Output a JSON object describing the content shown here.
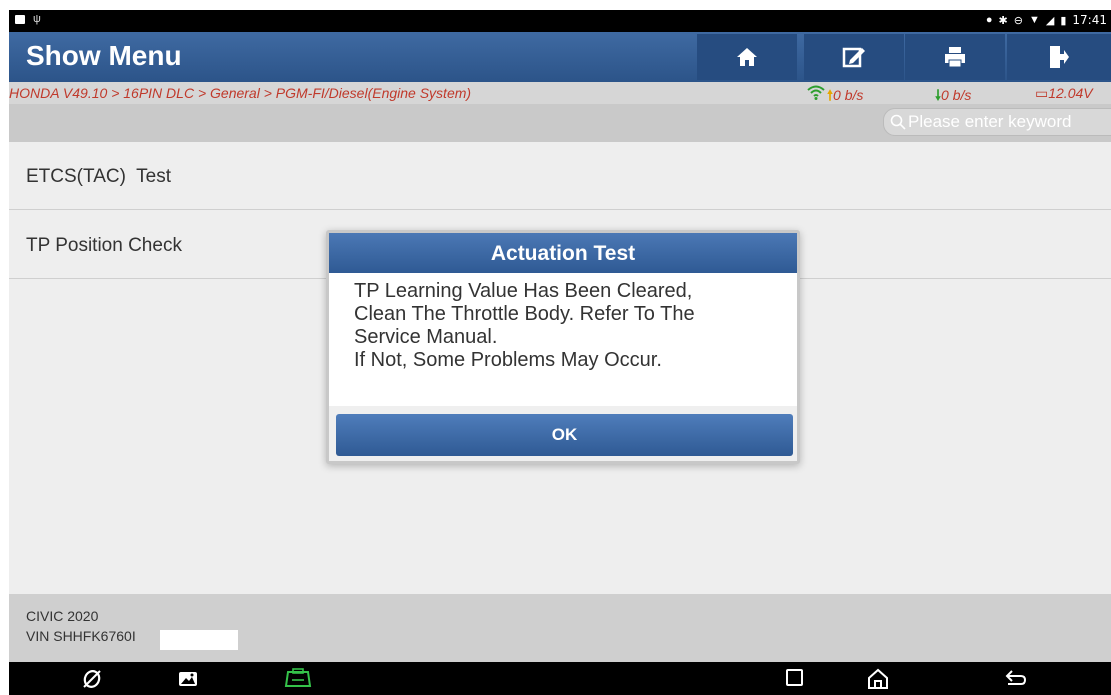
{
  "status_bar": {
    "time": "17:41",
    "icons": [
      "image-icon",
      "usb-icon",
      "location-icon",
      "bluetooth-icon",
      "dnd-icon",
      "wifi-icon",
      "signal-icon",
      "battery-icon"
    ]
  },
  "header": {
    "title": "Show Menu",
    "buttons": [
      "home-icon",
      "edit-report-icon",
      "print-icon",
      "exit-icon"
    ]
  },
  "breadcrumb": {
    "path": "HONDA V49.10 > 16PIN DLC > General > PGM-FI/Diesel(Engine System)",
    "upload_rate": "0 b/s",
    "download_rate": "0 b/s",
    "voltage": "12.04V"
  },
  "search": {
    "placeholder": "Please enter keyword"
  },
  "menu": {
    "items": [
      {
        "label": "ETCS(TAC)  Test"
      },
      {
        "label": "TP Position Check"
      }
    ]
  },
  "vehicle": {
    "model": "CIVIC 2020",
    "vin": "VIN SHHFK6760I"
  },
  "dialog": {
    "title": "Actuation Test",
    "message_lines": [
      "TP Learning Value Has Been Cleared,",
      "Clean The Throttle Body. Refer To The",
      "Service Manual.",
      "If Not, Some Problems May Occur."
    ],
    "ok_label": "OK"
  },
  "nav_bar": {
    "icons": [
      "browser-icon",
      "gallery-icon",
      "vci-icon",
      "recents-icon",
      "home-icon",
      "back-icon"
    ]
  },
  "colors": {
    "header_blue": "#2c5489",
    "breadcrumb_red": "#c0392b",
    "upload_arrow": "#e6a700",
    "download_arrow": "#2e9e2e"
  }
}
